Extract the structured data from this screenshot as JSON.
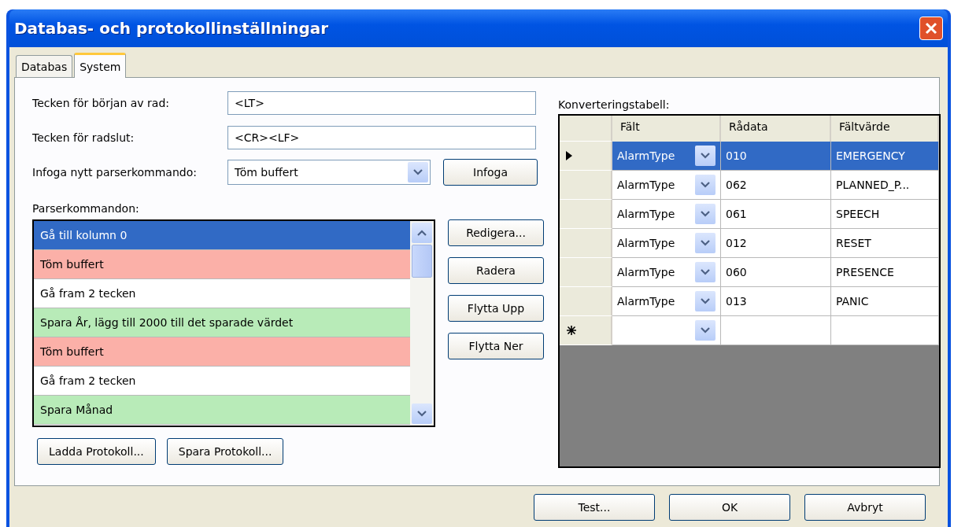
{
  "window": {
    "title": "Databas- och protokollinställningar"
  },
  "tabs": [
    {
      "label": "Databas",
      "selected": false
    },
    {
      "label": "System",
      "selected": true
    }
  ],
  "fields": [
    {
      "label": "Tecken för början av rad:",
      "value": "<LT>"
    },
    {
      "label": "Tecken för radslut:",
      "value": "<CR><LF>"
    }
  ],
  "insert_command": {
    "label": "Infoga nytt parserkommando:",
    "value": "Töm buffert",
    "button": "Infoga"
  },
  "parser_commands": {
    "label": "Parserkommandon:",
    "items": [
      {
        "text": "Gå till kolumn 0",
        "selected": true
      },
      {
        "text": "Töm buffert",
        "kind": "clear",
        "selected": false
      },
      {
        "text": "Gå fram 2 tecken",
        "kind": "move",
        "selected": false
      },
      {
        "text": "Spara År, lägg till 2000 till det sparade värdet",
        "kind": "save",
        "selected": false
      },
      {
        "text": "Töm buffert",
        "kind": "clear",
        "selected": false
      },
      {
        "text": "Gå fram 2 tecken",
        "kind": "move",
        "selected": false
      },
      {
        "text": "Spara Månad",
        "kind": "save",
        "selected": false
      }
    ],
    "buttons": [
      "Redigera...",
      "Radera",
      "Flytta Upp",
      "Flytta Ner"
    ]
  },
  "protocol_buttons": [
    "Ladda Protokoll...",
    "Spara Protokoll..."
  ],
  "conversion_table": {
    "label": "Konverteringstabell:",
    "columns": [
      "Fält",
      "Rådata",
      "Fältvärde"
    ],
    "rows": [
      {
        "kind": "data",
        "field": "AlarmType",
        "raw": "010",
        "value": "EMERGENCY",
        "selected": true
      },
      {
        "kind": "data",
        "field": "AlarmType",
        "raw": "062",
        "value": "PLANNED_P...",
        "selected": false
      },
      {
        "kind": "data",
        "field": "AlarmType",
        "raw": "061",
        "value": "SPEECH",
        "selected": false
      },
      {
        "kind": "data",
        "field": "AlarmType",
        "raw": "012",
        "value": "RESET",
        "selected": false
      },
      {
        "kind": "data",
        "field": "AlarmType",
        "raw": "060",
        "value": "PRESENCE",
        "selected": false
      },
      {
        "kind": "data",
        "field": "AlarmType",
        "raw": "013",
        "value": "PANIC",
        "selected": false
      },
      {
        "kind": "new",
        "selected": false
      }
    ]
  },
  "footer_buttons": [
    "Test...",
    "OK",
    "Avbryt"
  ]
}
